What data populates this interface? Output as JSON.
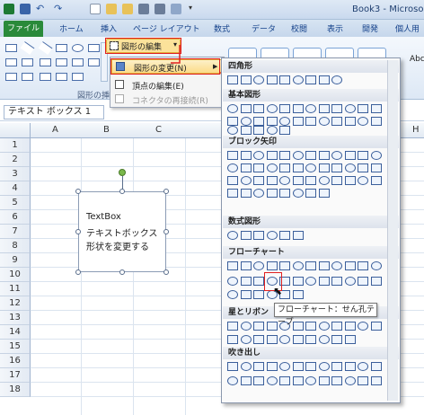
{
  "title_bar": {
    "doc_title": "Book3 - Microso"
  },
  "ribbon_tabs": [
    "ファイル",
    "ホーム",
    "挿入",
    "ページ レイアウト",
    "数式",
    "データ",
    "校閲",
    "表示",
    "開発",
    "個人用"
  ],
  "ribbon": {
    "edit_shape_label": "図形の編集",
    "group_label": "図形の挿",
    "abc": "Abc"
  },
  "context_menu": {
    "items": [
      {
        "label": "図形の変更(N)",
        "arrow": "▶"
      },
      {
        "label": "頂点の編集(E)"
      },
      {
        "label": "コネクタの再接続(R)"
      }
    ]
  },
  "name_box": {
    "value": "テキスト ボックス 1"
  },
  "columns": [
    "A",
    "B",
    "C",
    "H"
  ],
  "rows": [
    "1",
    "2",
    "3",
    "4",
    "5",
    "6",
    "7",
    "8",
    "9",
    "10",
    "11",
    "12",
    "13",
    "14",
    "15",
    "16",
    "17",
    "18"
  ],
  "textbox": {
    "line1": "TextBox",
    "line2": "テキストボックス",
    "line3": "形状を変更する"
  },
  "gallery": {
    "categories": [
      "四角形",
      "基本図形",
      "ブロック矢印",
      "数式図形",
      "フローチャート",
      "星とリボン",
      "吹き出し"
    ]
  },
  "tooltip": {
    "text": "フローチャート：せん孔テープ"
  }
}
